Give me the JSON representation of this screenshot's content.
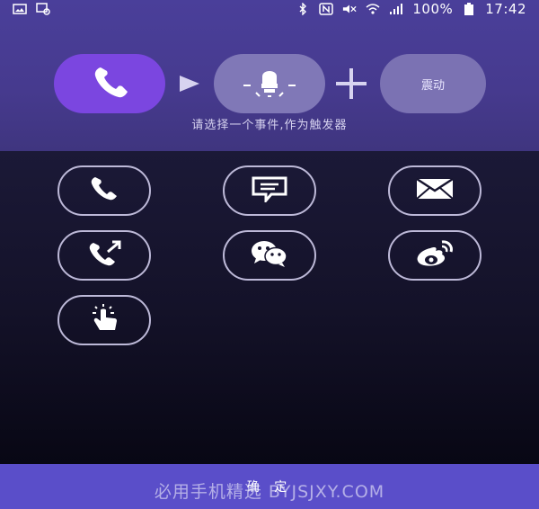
{
  "status_bar": {
    "battery": "100%",
    "time": "17:42"
  },
  "flow": {
    "vibrate_label": "震动"
  },
  "hint": "请选择一个事件,作为触发器",
  "events": [
    {
      "icon": "phone-icon"
    },
    {
      "icon": "message-icon"
    },
    {
      "icon": "mail-icon"
    },
    {
      "icon": "outgoing-call-icon"
    },
    {
      "icon": "wechat-icon"
    },
    {
      "icon": "weibo-icon"
    },
    {
      "icon": "tap-gesture-icon"
    }
  ],
  "footer": {
    "confirm_label": "确 定",
    "watermark": "必用手机精选 BYJSJXY.COM"
  },
  "colors": {
    "accent": "#7b46e0",
    "top_bg": "#4a3f9a",
    "bottom_bar": "#5a4ec9"
  }
}
